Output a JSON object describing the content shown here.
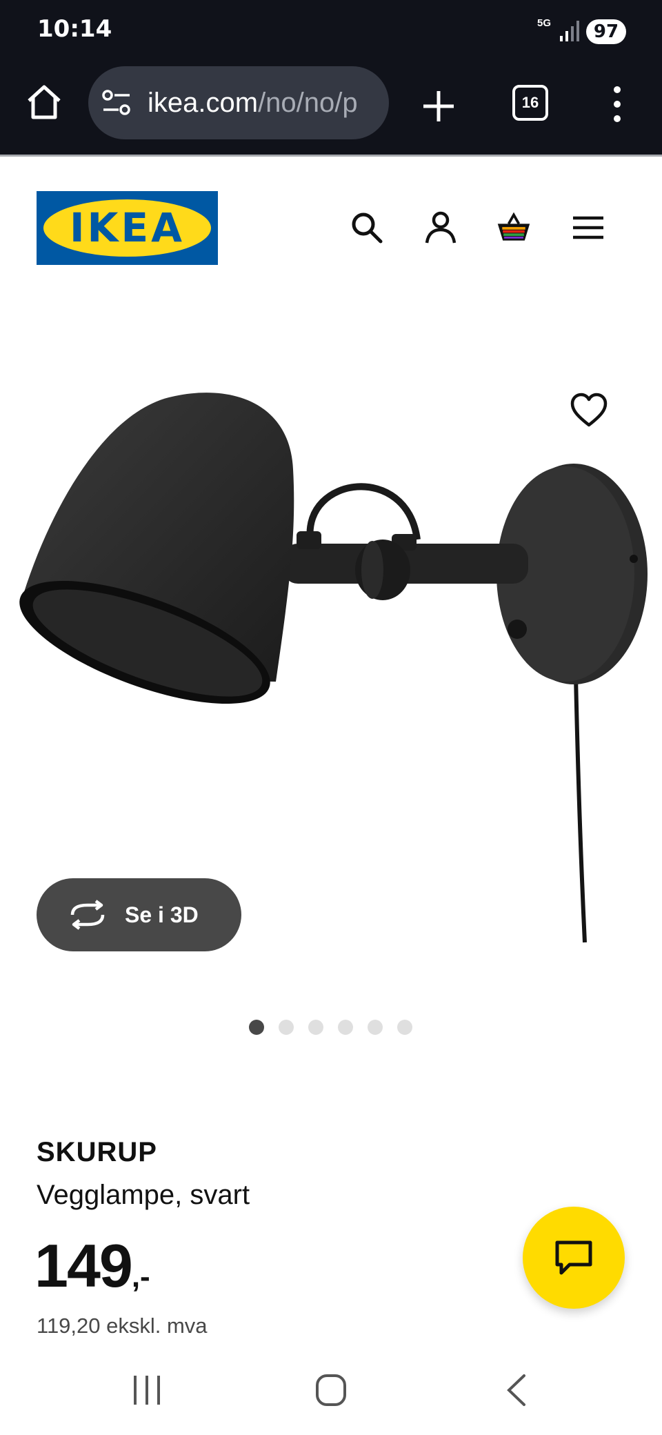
{
  "status_bar": {
    "time": "10:14",
    "network": "5G",
    "battery": "97"
  },
  "browser": {
    "url_host": "ikea.com",
    "url_path": "/no/no/p",
    "open_tabs": "16",
    "icons": [
      "home-icon",
      "site-settings-icon",
      "new-tab-icon",
      "tab-switcher-icon",
      "more-menu-icon"
    ]
  },
  "header": {
    "logo_text": "IKEA",
    "icons": [
      "search-icon",
      "account-icon",
      "cart-icon",
      "hamburger-menu-icon"
    ]
  },
  "gallery": {
    "view_3d_label": "Se i 3D",
    "image_count": 6,
    "active_index": 0,
    "favorite_icon": "heart-icon"
  },
  "product": {
    "name": "SKURUP",
    "description": "Vegglampe, svart",
    "price": "149",
    "price_suffix": ",-",
    "price_ex_vat": "119,20 ekskl. mva"
  },
  "chat": {
    "icon": "chat-bubble-icon",
    "color": "#ffdb00"
  },
  "colors": {
    "ikea_blue": "#0058a3",
    "ikea_yellow": "#ffda1a",
    "dark_button": "#484848",
    "system_bar": "#10121a"
  }
}
